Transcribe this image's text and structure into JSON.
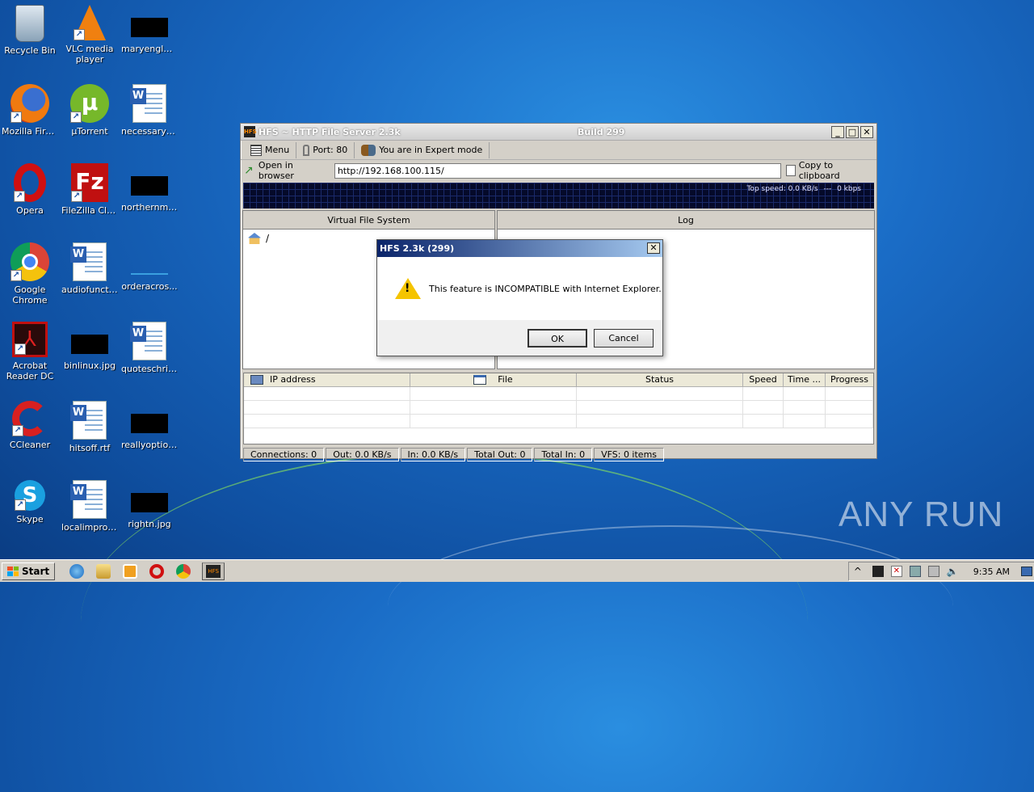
{
  "desktop": {
    "icons": [
      {
        "label": "Recycle Bin"
      },
      {
        "label": "VLC media player"
      },
      {
        "label": "maryenglan..."
      },
      {
        "label": "Mozilla Firefox"
      },
      {
        "label": "µTorrent"
      },
      {
        "label": "necessaryb..."
      },
      {
        "label": "Opera"
      },
      {
        "label": "FileZilla Client"
      },
      {
        "label": "northernmo..."
      },
      {
        "label": "Google Chrome"
      },
      {
        "label": "audiofuncti..."
      },
      {
        "label": "orderacros..."
      },
      {
        "label": "Acrobat Reader DC"
      },
      {
        "label": "binlinux.jpg"
      },
      {
        "label": "quoteschris.rtf"
      },
      {
        "label": "CCleaner"
      },
      {
        "label": "hitsoff.rtf"
      },
      {
        "label": "reallyoption..."
      },
      {
        "label": "Skype"
      },
      {
        "label": "localimprove..."
      },
      {
        "label": "rightn.jpg"
      }
    ]
  },
  "hfs_window": {
    "title": "HFS ~ HTTP File Server 2.3k",
    "build": "Build 299",
    "toolbar": {
      "menu": "Menu",
      "port": "Port: 80",
      "mode": "You are in Expert mode"
    },
    "browser_row": {
      "open_label": "Open in browser",
      "url": "http://192.168.100.115/",
      "copy_label": "Copy to clipboard"
    },
    "graph": {
      "top_speed": "Top speed: 0.0 KB/s",
      "sep": "---",
      "kbps": "0 kbps"
    },
    "vfs": {
      "header": "Virtual File System",
      "root": "/"
    },
    "log": {
      "header": "Log"
    },
    "connections": {
      "columns": [
        "IP address",
        "File",
        "Status",
        "Speed",
        "Time ...",
        "Progress"
      ]
    },
    "status": [
      "Connections: 0",
      "Out: 0.0 KB/s",
      "In: 0.0 KB/s",
      "Total Out: 0",
      "Total In: 0",
      "VFS: 0 items"
    ]
  },
  "dialog": {
    "title": "HFS 2.3k (299)",
    "message": "This feature is INCOMPATIBLE with Internet Explorer.",
    "ok": "OK",
    "cancel": "Cancel"
  },
  "taskbar": {
    "start": "Start",
    "time": "9:35 AM",
    "active_app": "HFS"
  },
  "watermark": "ANY RUN"
}
